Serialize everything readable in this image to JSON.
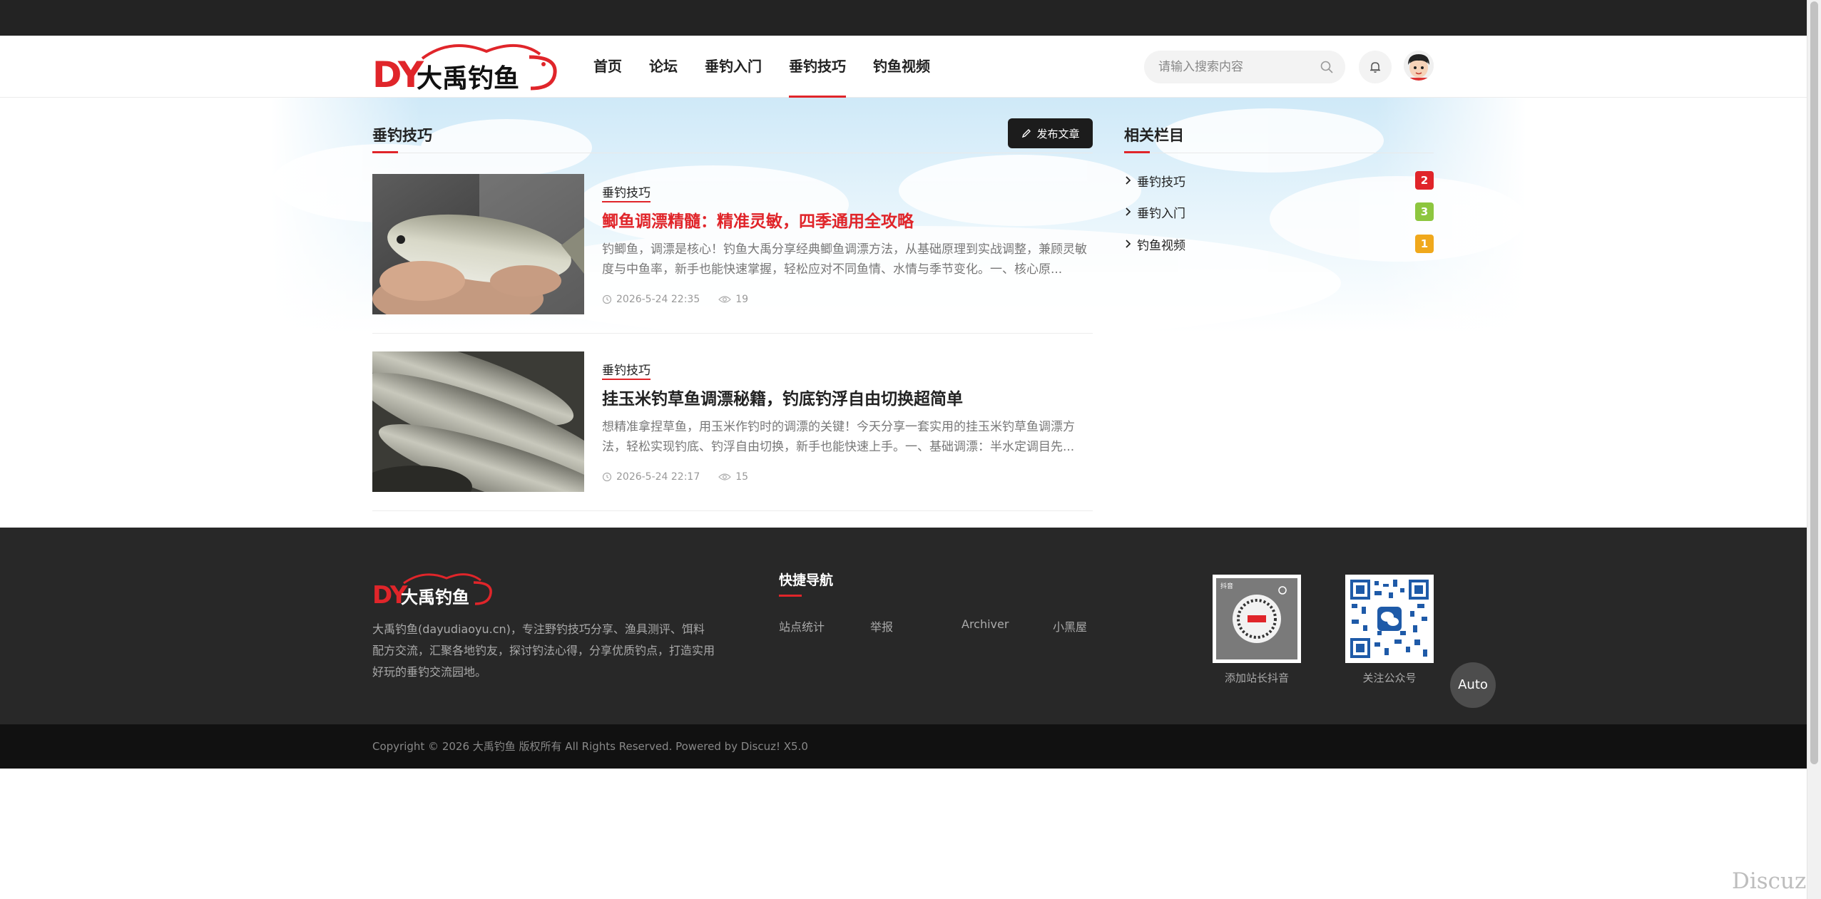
{
  "site": {
    "logo_text": "大禹钓鱼",
    "logo_letters": "DY"
  },
  "nav": {
    "items": [
      {
        "label": "首页"
      },
      {
        "label": "论坛"
      },
      {
        "label": "垂钓入门"
      },
      {
        "label": "垂钓技巧",
        "active": true
      },
      {
        "label": "钓鱼视频"
      }
    ]
  },
  "search": {
    "placeholder": "请输入搜索内容"
  },
  "main": {
    "section_title": "垂钓技巧",
    "publish_label": "发布文章",
    "posts": [
      {
        "category": "垂钓技巧",
        "title": "鲫鱼调漂精髓：精准灵敏，四季通用全攻略",
        "excerpt": "钓鲫鱼，调漂是核心！钓鱼大禹分享经典鲫鱼调漂方法，从基础原理到实战调整，兼顾灵敏度与中鱼率，新手也能快速掌握，轻松应对不同鱼情、水情与季节变化。一、核心原...",
        "date": "2026-5-24 22:35",
        "views": "19"
      },
      {
        "category": "垂钓技巧",
        "title": "挂玉米钓草鱼调漂秘籍，钓底钓浮自由切换超简单",
        "excerpt": "想精准拿捏草鱼，用玉米作钓时的调漂的关键！今天分享一套实用的挂玉米钓草鱼调漂方法，轻松实现钓底、钓浮自由切换，新手也能快速上手。一、基础调漂：半水定调目先...",
        "date": "2026-5-24 22:17",
        "views": "15"
      }
    ]
  },
  "sidebar": {
    "title": "相关栏目",
    "items": [
      {
        "label": "垂钓技巧",
        "count": "2",
        "color": "#e0252a"
      },
      {
        "label": "垂钓入门",
        "count": "3",
        "color": "#8dc63f"
      },
      {
        "label": "钓鱼视频",
        "count": "1",
        "color": "#f0a81c"
      }
    ]
  },
  "footer": {
    "description": "大禹钓鱼(dayudiaoyu.cn)，专注野钓技巧分享、渔具测评、饵料配方交流，汇聚各地钓友，探讨钓法心得，分享优质钓点，打造实用好玩的垂钓交流园地。",
    "quick_nav_title": "快捷导航",
    "quick_links": [
      "站点统计",
      "举报",
      "Archiver",
      "小黑屋"
    ],
    "qr_douyin_caption": "添加站长抖音",
    "qr_wechat_caption": "关注公众号",
    "douyin_badge": "抖音"
  },
  "copyright": "Copyright © 2026 大禹钓鱼 版权所有 All Rights Reserved. Powered by Discuz! X5.0",
  "auto_label": "Auto",
  "watermark": "Discuz!"
}
